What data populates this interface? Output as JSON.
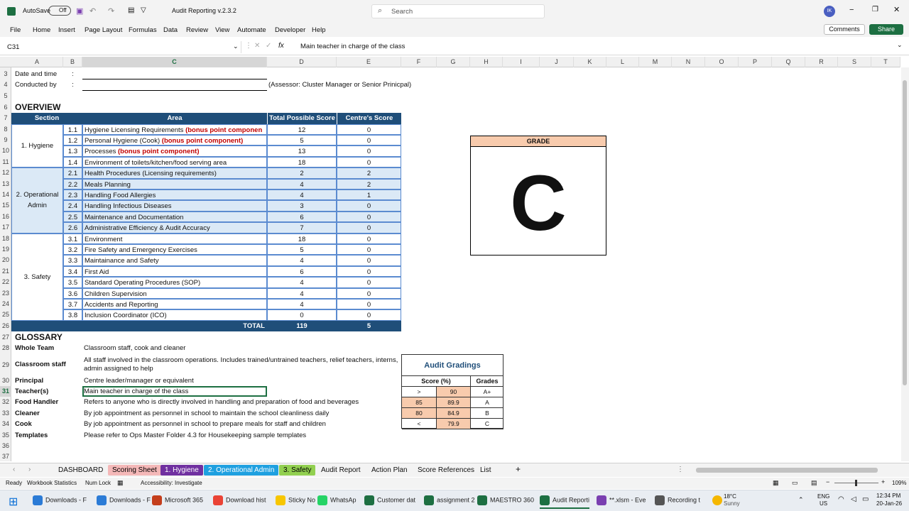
{
  "titlebar": {
    "autosave": "AutoSave",
    "autosave_state": "Off",
    "filename": "Audit Reporting v.2.3.2",
    "search": "Search",
    "avatar": "IK"
  },
  "menu": [
    "File",
    "Home",
    "Insert",
    "Page Layout",
    "Formulas",
    "Data",
    "Review",
    "View",
    "Automate",
    "Developer",
    "Help"
  ],
  "menu_right": {
    "comments": "Comments",
    "share": "Share"
  },
  "formula": {
    "namebox": "C31",
    "fx": "fx",
    "value": "Main teacher in charge of the class"
  },
  "columns": [
    "A",
    "B",
    "C",
    "D",
    "E",
    "F",
    "G",
    "H",
    "I",
    "J",
    "K",
    "L",
    "M",
    "N",
    "O",
    "P",
    "Q",
    "R",
    "S",
    "T"
  ],
  "rows": [
    "3",
    "4",
    "5",
    "6",
    "7",
    "8",
    "9",
    "10",
    "11",
    "12",
    "13",
    "14",
    "15",
    "16",
    "17",
    "18",
    "19",
    "20",
    "21",
    "22",
    "23",
    "24",
    "25",
    "26",
    "27",
    "28",
    "29",
    "30",
    "31",
    "32",
    "33",
    "34",
    "35",
    "36",
    "37"
  ],
  "header": {
    "date_label": "Date and time",
    "conducted_label": "Conducted by",
    "colon": ":",
    "assessor": "(Assessor: Cluster Manager or Senior Prinicpal)"
  },
  "overview": {
    "title": "OVERVIEW",
    "col_section": "Section",
    "col_area": "Area",
    "col_total": "Total Possible Score",
    "col_centre": "Centre's Score",
    "sections": [
      "1. Hygiene",
      "2. Operational Admin",
      "3. Safety"
    ],
    "items": [
      {
        "no": "1.1",
        "area": "Hygiene Licensing Requirements ",
        "bonus": "(bonus point componen",
        "total": "12",
        "score": "0"
      },
      {
        "no": "1.2",
        "area": "Personal Hygiene (Cook) ",
        "bonus": "(bonus point component)",
        "total": "5",
        "score": "0"
      },
      {
        "no": "1.3",
        "area": "Processes ",
        "bonus": "(bonus point component)",
        "total": "13",
        "score": "0"
      },
      {
        "no": "1.4",
        "area": "Environment of toilets/kitchen/food serving area",
        "bonus": "",
        "total": "18",
        "score": "0"
      },
      {
        "no": "2.1",
        "area": "Health Procedures (Licensing requirements)",
        "bonus": "",
        "total": "2",
        "score": "2"
      },
      {
        "no": "2.2",
        "area": "Meals Planning",
        "bonus": "",
        "total": "4",
        "score": "2"
      },
      {
        "no": "2.3",
        "area": "Handling Food Allergies",
        "bonus": "",
        "total": "4",
        "score": "1"
      },
      {
        "no": "2.4",
        "area": "Handling Infectious Diseases",
        "bonus": "",
        "total": "3",
        "score": "0"
      },
      {
        "no": "2.5",
        "area": "Maintenance and Documentation",
        "bonus": "",
        "total": "6",
        "score": "0"
      },
      {
        "no": "2.6",
        "area": "Administrative Efficiency & Audit Accuracy",
        "bonus": "",
        "total": "7",
        "score": "0"
      },
      {
        "no": "3.1",
        "area": "Environment",
        "bonus": "",
        "total": "18",
        "score": "0"
      },
      {
        "no": "3.2",
        "area": "Fire Safety and Emergency Exercises",
        "bonus": "",
        "total": "5",
        "score": "0"
      },
      {
        "no": "3.3",
        "area": "Maintainance and Safety",
        "bonus": "",
        "total": "4",
        "score": "0"
      },
      {
        "no": "3.4",
        "area": "First Aid",
        "bonus": "",
        "total": "6",
        "score": "0"
      },
      {
        "no": "3.5",
        "area": "Standard Operating Procedures (SOP)",
        "bonus": "",
        "total": "4",
        "score": "0"
      },
      {
        "no": "3.6",
        "area": "Children Supervision",
        "bonus": "",
        "total": "4",
        "score": "0"
      },
      {
        "no": "3.7",
        "area": "Accidents and Reporting",
        "bonus": "",
        "total": "4",
        "score": "0"
      },
      {
        "no": "3.8",
        "area": "Inclusion Coordinator (ICO)",
        "bonus": "",
        "total": "0",
        "score": "0"
      }
    ],
    "total_label": "TOTAL",
    "total_possible": "119",
    "total_score": "5"
  },
  "grade": {
    "label": "GRADE",
    "value": "C"
  },
  "glossary": {
    "title": "GLOSSARY",
    "items": [
      {
        "term": "Whole Team",
        "def": "Classroom staff, cook and cleaner"
      },
      {
        "term": "Classroom staff",
        "def": "All staff involved in the classroom operations. Includes trained/untrained teachers, relief teachers, interns,",
        "def2": "admin assigned to help"
      },
      {
        "term": "Principal",
        "def": "Centre leader/manager or equivalent"
      },
      {
        "term": "Teacher(s)",
        "def": "Main teacher in charge of the class"
      },
      {
        "term": "Food Handler",
        "def": "Refers to anyone who is directly involved in handling and preparation of food and beverages"
      },
      {
        "term": "Cleaner",
        "def": "By job appointment as personnel in school to maintain the school cleanliness daily"
      },
      {
        "term": "Cook",
        "def": "By job appointment as personnel in school to prepare meals for staff and children"
      },
      {
        "term": "Templates",
        "def": "Please refer to Ops Master Folder 4.3 for Housekeeping sample templates"
      }
    ]
  },
  "gradings": {
    "title": "Audit Gradings",
    "col_score": "Score (%)",
    "col_grade": "Grades",
    "rows": [
      {
        "a": ">",
        "b": "90",
        "g": "A+"
      },
      {
        "a": "85",
        "b": "89.9",
        "g": "A"
      },
      {
        "a": "80",
        "b": "84.9",
        "g": "B"
      },
      {
        "a": "<",
        "b": "79.9",
        "g": "C"
      }
    ]
  },
  "tabs": [
    "DASHBOARD",
    "Scoring Sheet",
    "1. Hygiene",
    "2. Operational Admin",
    "3. Safety",
    "Audit Report",
    "Action Plan",
    "Score References",
    "List"
  ],
  "status": {
    "ready": "Ready",
    "stats": "Workbook Statistics",
    "numlock": "Num Lock",
    "access": "Accessibility: Investigate",
    "zoom": "109%"
  },
  "taskbar": {
    "items": [
      "Downloads - F",
      "Downloads - F",
      "Microsoft 365",
      "Download hist",
      "Sticky No",
      "WhatsAp",
      "Customer dat",
      "assignment 2",
      "MAESTRO 360",
      "Audit Reporti",
      "**.xlsm - Eve",
      "Recording t"
    ],
    "weather_temp": "18°C",
    "weather_desc": "Sunny",
    "lang": "ENG",
    "region": "US",
    "time": "12:34 PM",
    "date": "20-Jan-26"
  }
}
